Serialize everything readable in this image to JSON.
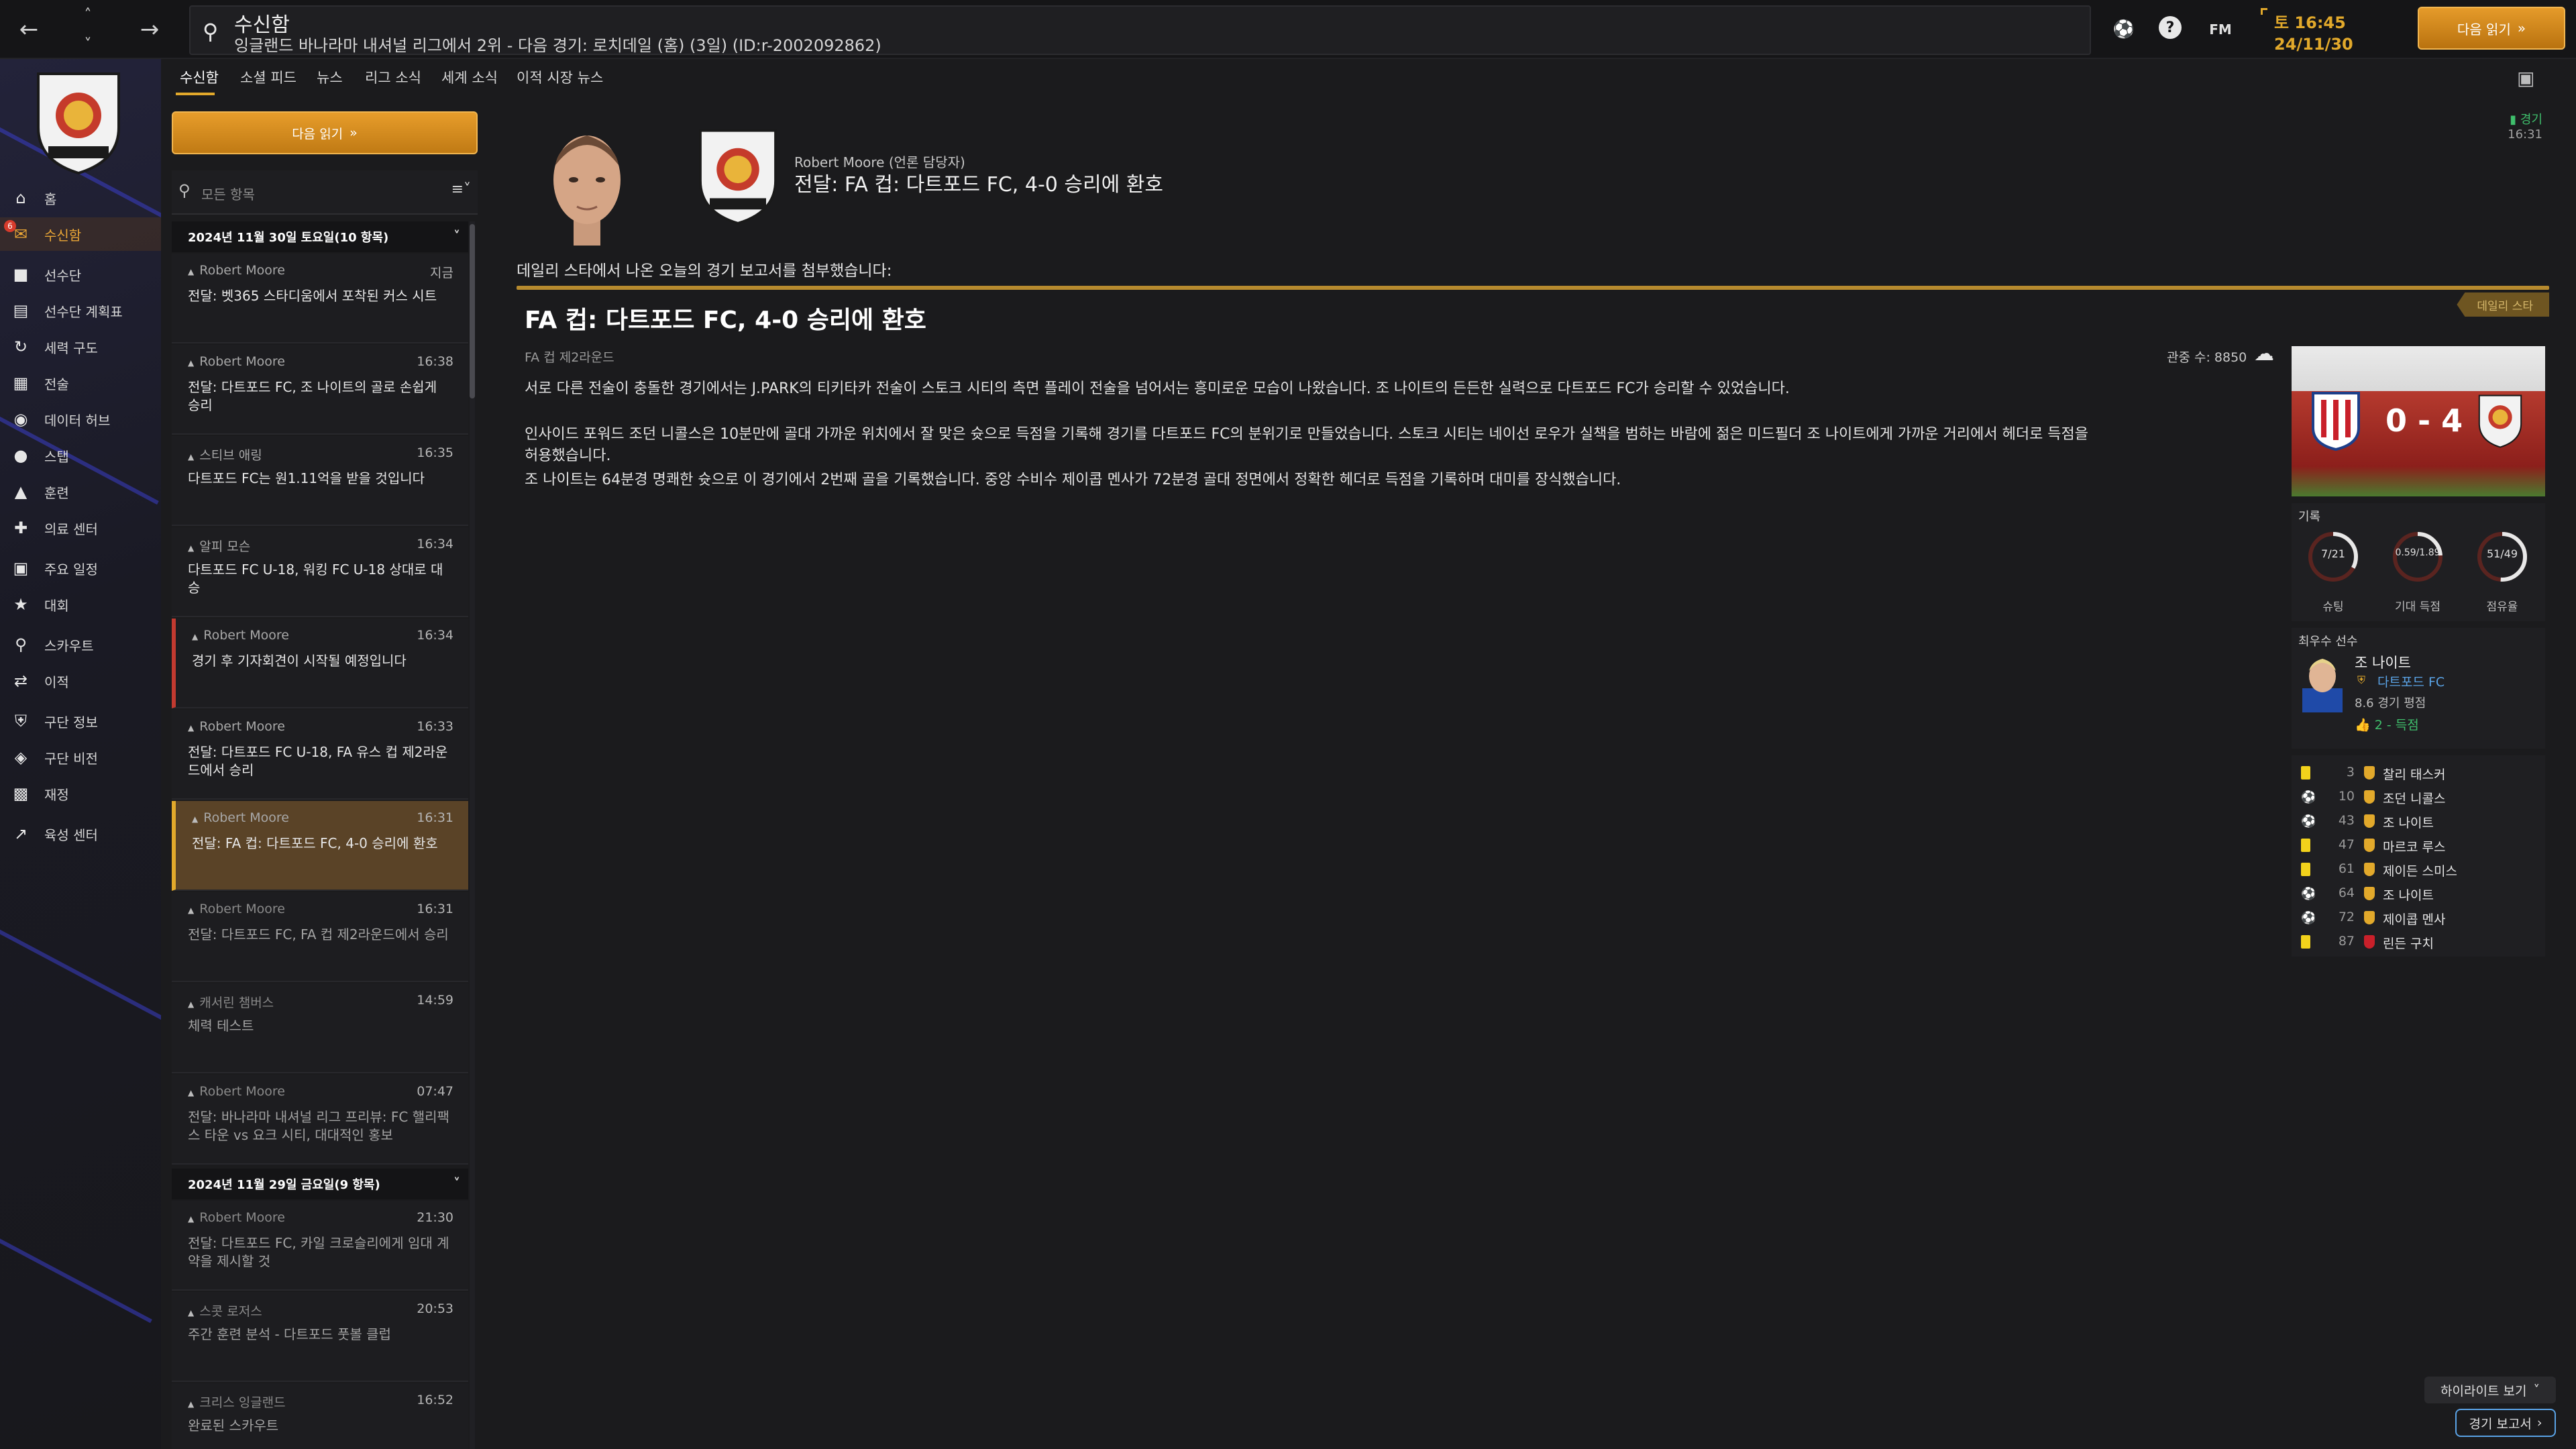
{
  "topbar": {
    "title": "수신함",
    "subtitle": "잉글랜드 바나라마 내셔널 리그에서 2위 - 다음 경기: 로치데일 (홈) (3일) (ID:r-2002092862)",
    "help_label": "?",
    "fm_label": "FM",
    "date_line1": "토 16:45",
    "date_line2": "24/11/30",
    "continue_label": "다음 읽기"
  },
  "sidebar": {
    "badge": "6",
    "items": [
      {
        "label": "홈",
        "icon": "home-icon"
      },
      {
        "label": "수신함",
        "icon": "inbox-icon"
      },
      {
        "label": "선수단",
        "icon": "shirt-icon"
      },
      {
        "label": "선수단 계획표",
        "icon": "clipboard-icon"
      },
      {
        "label": "세력 구도",
        "icon": "dynamics-icon"
      },
      {
        "label": "전술",
        "icon": "tactics-icon"
      },
      {
        "label": "데이터 허브",
        "icon": "data-hub-icon"
      },
      {
        "label": "스탭",
        "icon": "staff-icon"
      },
      {
        "label": "훈련",
        "icon": "training-icon"
      },
      {
        "label": "의료 센터",
        "icon": "medical-icon"
      },
      {
        "label": "주요 일정",
        "icon": "calendar-icon"
      },
      {
        "label": "대회",
        "icon": "trophy-icon"
      },
      {
        "label": "스카우트",
        "icon": "scout-icon"
      },
      {
        "label": "이적",
        "icon": "transfer-icon"
      },
      {
        "label": "구단 정보",
        "icon": "club-info-icon"
      },
      {
        "label": "구단 비전",
        "icon": "vision-icon"
      },
      {
        "label": "재정",
        "icon": "finance-icon"
      },
      {
        "label": "육성 센터",
        "icon": "development-icon"
      }
    ]
  },
  "tabs": [
    "수신함",
    "소셜 피드",
    "뉴스",
    "리그 소식",
    "세계 소식",
    "이적 시장 뉴스"
  ],
  "list": {
    "continue_label": "다음 읽기",
    "filter_placeholder": "모든 항목",
    "groups": [
      {
        "header": "2024년 11월 30일 토요일(10 항목)"
      },
      {
        "header": "2024년 11월 29일 금요일(9 항목)"
      }
    ],
    "messages": [
      {
        "sender": "Robert Moore",
        "time": "지금",
        "subject": "전달: 벳365 스타디움에서 포착된 커스 시트"
      },
      {
        "sender": "Robert Moore",
        "time": "16:38",
        "subject": "전달: 다트포드 FC, 조 나이트의 골로 손쉽게 승리"
      },
      {
        "sender": "스티브 애링",
        "time": "16:35",
        "subject": "다트포드 FC는 원1.11억을 받을 것입니다"
      },
      {
        "sender": "알피 모슨",
        "time": "16:34",
        "subject": "다트포드 FC U-18, 워킹 FC U-18 상대로 대승"
      },
      {
        "sender": "Robert Moore",
        "time": "16:34",
        "subject": "경기 후 기자회견이 시작될 예정입니다"
      },
      {
        "sender": "Robert Moore",
        "time": "16:33",
        "subject": "전달: 다트포드 FC U-18, FA 유스 컵 제2라운드에서 승리"
      },
      {
        "sender": "Robert Moore",
        "time": "16:31",
        "subject": "전달: FA 컵: 다트포드 FC, 4-0 승리에 환호"
      },
      {
        "sender": "Robert Moore",
        "time": "16:31",
        "subject": "전달: 다트포드 FC, FA 컵 제2라운드에서 승리"
      },
      {
        "sender": "캐서린 챔버스",
        "time": "14:59",
        "subject": "체력 테스트"
      },
      {
        "sender": "Robert Moore",
        "time": "07:47",
        "subject": "전달: 바나라마 내셔널 리그 프리뷰: FC 핼리팩스 타운 vs 요크 시티, 대대적인 홍보"
      },
      {
        "sender": "Robert Moore",
        "time": "21:30",
        "subject": "전달: 다트포드 FC, 카일 크로슬리에게 임대 계약을 제시할 것"
      },
      {
        "sender": "스콧 로저스",
        "time": "20:53",
        "subject": "주간 훈련 분석 - 다트포드 풋볼 클럽"
      },
      {
        "sender": "크리스 잉글랜드",
        "time": "16:52",
        "subject": "완료된 스카우트"
      }
    ]
  },
  "article": {
    "status_label": "경기",
    "status_time": "16:31",
    "sender_line": "Robert Moore (언론 담당자)",
    "headline": "전달: FA 컵: 다트포드 FC, 4-0 승리에 환호",
    "intro": "데일리 스타에서 나온 오늘의 경기 보고서를 첨부했습니다:",
    "paper_tag": "데일리 스타",
    "title": "FA 컵: 다트포드 FC, 4-0 승리에 환호",
    "competition": "FA 컵 제2라운드",
    "attendance": "관중 수: 8850",
    "paragraphs": [
      "서로 다른 전술이 충돌한 경기에서는 J.PARK의 티키타카 전술이 스토크 시티의 측면 플레이 전술을 넘어서는 흥미로운 모습이 나왔습니다. 조 나이트의 든든한 실력으로 다트포드 FC가 승리할 수 있었습니다.",
      "인사이드 포워드 조던 니콜스은 10분만에 골대 가까운 위치에서 잘 맞은 슛으로 득점을 기록해 경기를 다트포드 FC의 분위기로 만들었습니다. 스토크 시티는 네이선 로우가 실책을 범하는 바람에 젊은 미드필더 조 나이트에게 가까운 거리에서 헤더로 득점을 허용했습니다.",
      "조 나이트는 64분경 명쾌한 슛으로 이 경기에서 2번째 골을 기록했습니다. 중앙 수비수 제이콥 멘사가 72분경 골대 정면에서 정확한 헤더로 득점을 기록하며 대미를 장식했습니다."
    ]
  },
  "match": {
    "score": "0 - 4",
    "stats_header": "기록",
    "stats": [
      {
        "value": "7/21",
        "label": "슈팅",
        "fraction": 0.33
      },
      {
        "value": "0.59/1.89",
        "label": "기대 득점",
        "fraction": 0.24
      },
      {
        "value": "51/49",
        "label": "점유율",
        "fraction": 0.51
      }
    ],
    "potm_header": "최우수 선수",
    "potm_name": "조 나이트",
    "potm_club": "다트포드 FC",
    "potm_rating": "8.6 경기 평점",
    "potm_goals": "2 - 득점",
    "events": [
      {
        "minute": "3",
        "name": "찰리 태스커",
        "type": "yellow",
        "team": "home"
      },
      {
        "minute": "10",
        "name": "조던 니콜스",
        "type": "goal",
        "team": "home"
      },
      {
        "minute": "43",
        "name": "조 나이트",
        "type": "goal",
        "team": "home"
      },
      {
        "minute": "47",
        "name": "마르코 루스",
        "type": "yellow",
        "team": "home"
      },
      {
        "minute": "61",
        "name": "제이든 스미스",
        "type": "yellow",
        "team": "home"
      },
      {
        "minute": "64",
        "name": "조 나이트",
        "type": "goal",
        "team": "home"
      },
      {
        "minute": "72",
        "name": "제이콥 멘사",
        "type": "goal",
        "team": "home"
      },
      {
        "minute": "87",
        "name": "린든 구치",
        "type": "yellow",
        "team": "away"
      }
    ],
    "highlights_label": "하이라이트 보기",
    "report_label": "경기 보고서"
  },
  "colors": {
    "accent": "#e2a92b",
    "positive": "#3fbf6c",
    "link": "#5aa3e6",
    "alert": "#d63b2c"
  }
}
